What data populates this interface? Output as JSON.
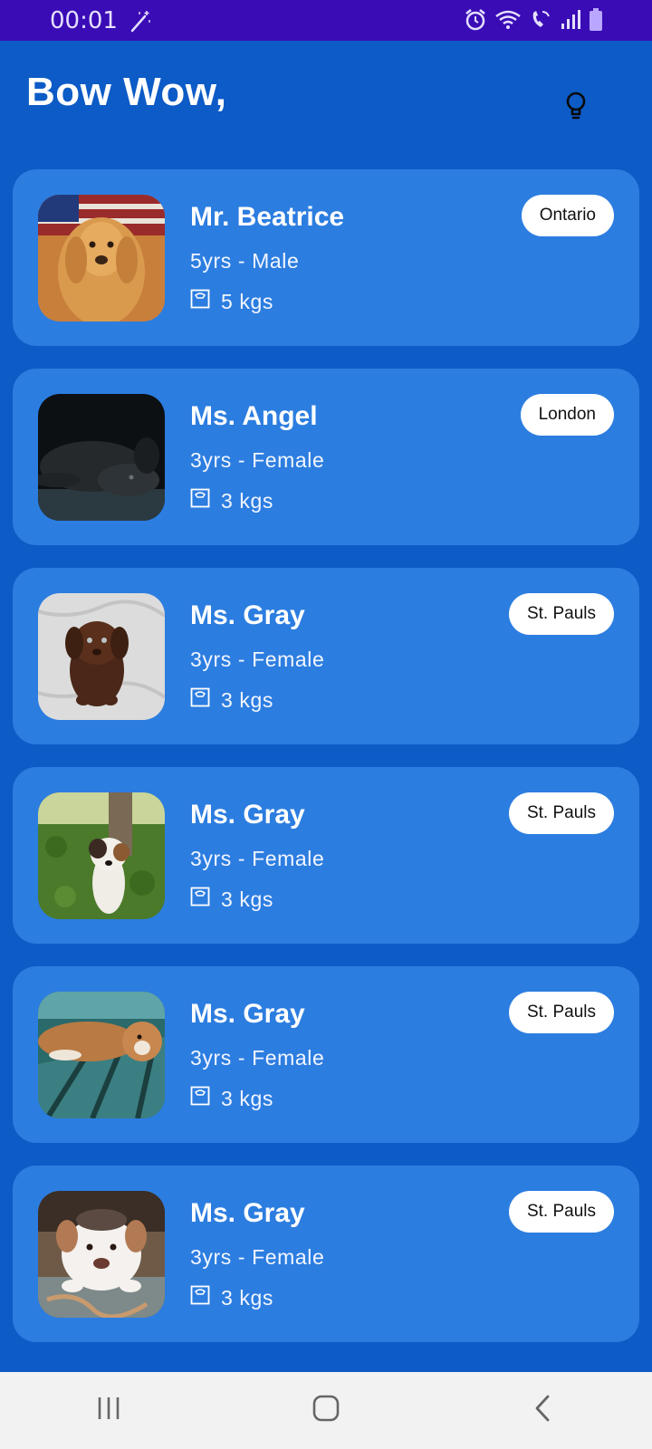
{
  "status_bar": {
    "time": "00:01",
    "icons": [
      "magic-wand-icon",
      "alarm-icon",
      "wifi-icon",
      "wifi-call-icon",
      "signal-icon",
      "battery-icon"
    ]
  },
  "header": {
    "title": "Bow Wow,",
    "action_icon": "lightbulb-icon"
  },
  "pets": [
    {
      "name": "Mr. Beatrice",
      "details": "5yrs - Male",
      "weight": "5 kgs",
      "location": "Ontario",
      "photo": "golden-retriever"
    },
    {
      "name": "Ms. Angel",
      "details": "3yrs - Female",
      "weight": "3 kgs",
      "location": "London",
      "photo": "black-dog-lying"
    },
    {
      "name": "Ms. Gray",
      "details": "3yrs - Female",
      "weight": "3 kgs",
      "location": "St. Pauls",
      "photo": "brown-puppy"
    },
    {
      "name": "Ms. Gray",
      "details": "3yrs - Female",
      "weight": "3 kgs",
      "location": "St. Pauls",
      "photo": "terrier-on-grass"
    },
    {
      "name": "Ms. Gray",
      "details": "3yrs - Female",
      "weight": "3 kgs",
      "location": "St. Pauls",
      "photo": "dog-on-bench"
    },
    {
      "name": "Ms. Gray",
      "details": "3yrs - Female",
      "weight": "3 kgs",
      "location": "St. Pauls",
      "photo": "white-pitbull"
    }
  ],
  "nav": {
    "buttons": [
      "recent-apps-icon",
      "home-icon",
      "back-icon"
    ]
  },
  "colors": {
    "background": "#0d5bc6",
    "card": "#2c7de0",
    "status_bar": "#3a0cb5",
    "chip": "#ffffff",
    "nav_bar": "#f2f2f2"
  }
}
